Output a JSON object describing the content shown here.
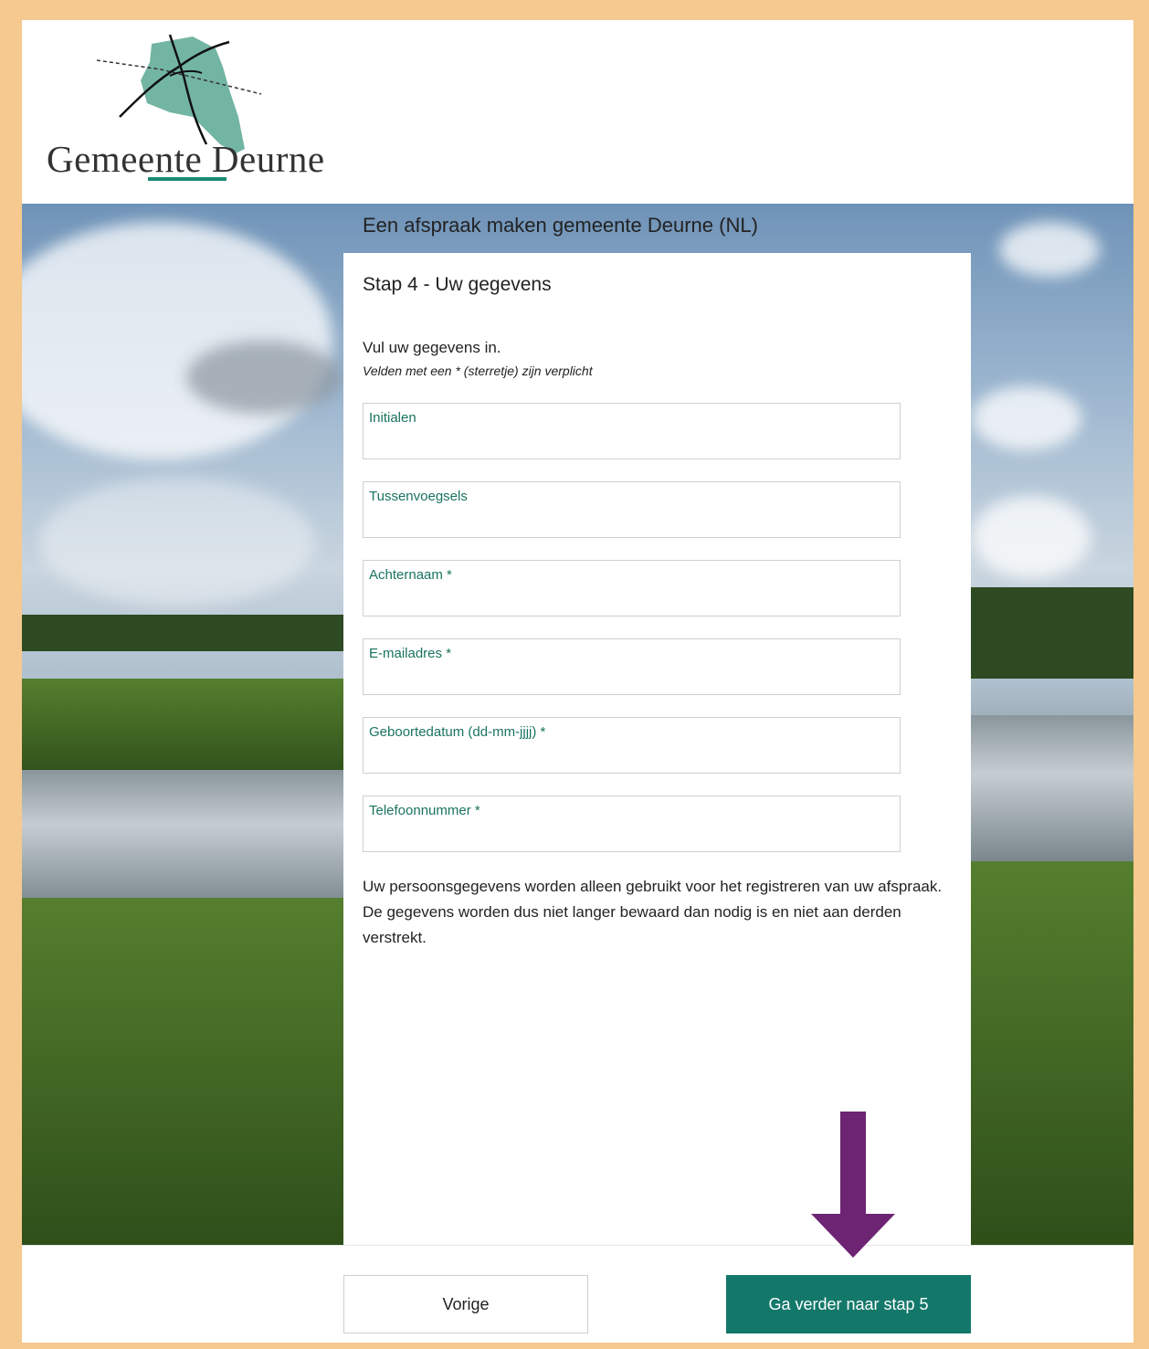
{
  "logo": {
    "text": "Gemeente Deurne"
  },
  "page": {
    "title": "Een afspraak maken gemeente Deurne (NL)"
  },
  "form": {
    "step_title": "Stap 4 - Uw gegevens",
    "intro": "Vul uw gegevens in.",
    "hint": "Velden met een * (sterretje) zijn verplicht",
    "fields": [
      {
        "label": "Initialen",
        "value": ""
      },
      {
        "label": "Tussenvoegsels",
        "value": ""
      },
      {
        "label": "Achternaam *",
        "value": ""
      },
      {
        "label": "E-mailadres *",
        "value": ""
      },
      {
        "label": "Geboortedatum (dd-mm-jjjj) *",
        "value": ""
      },
      {
        "label": "Telefoonnummer *",
        "value": ""
      }
    ],
    "privacy": "Uw persoonsgegevens worden alleen gebruikt voor het registreren van uw afspraak. De gegevens worden dus niet langer bewaard dan nodig is en niet aan derden verstrekt."
  },
  "footer": {
    "prev_label": "Vorige",
    "next_label": "Ga verder naar stap 5"
  },
  "annotation": {
    "icon": "arrow-down-icon",
    "color": "#6d2473"
  },
  "colors": {
    "accent": "#13786a",
    "label": "#19735f",
    "frame": "#f5c98f"
  }
}
